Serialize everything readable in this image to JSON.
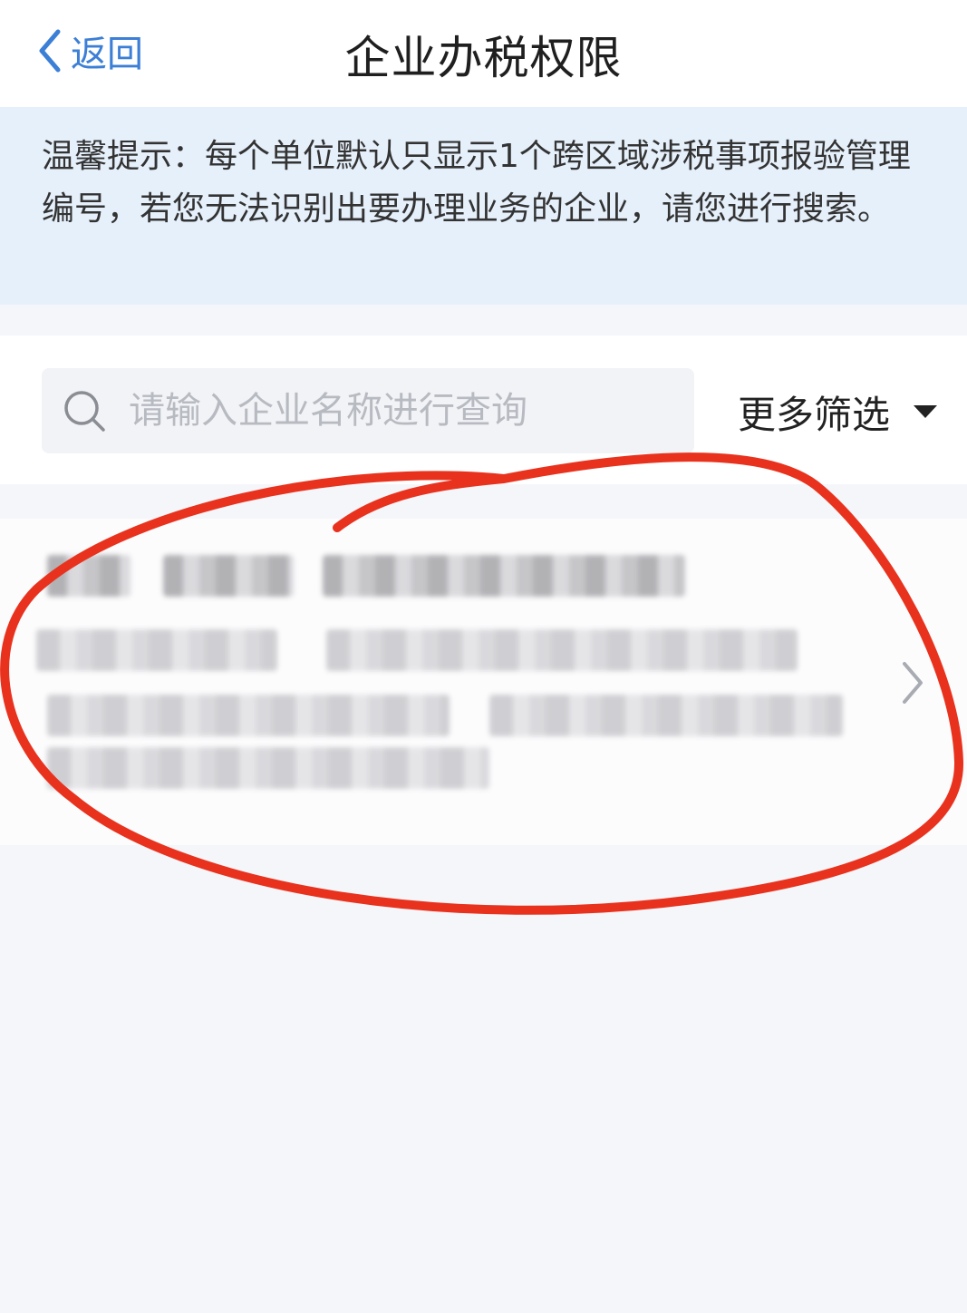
{
  "nav": {
    "back_label": "返回",
    "title": "企业办税权限"
  },
  "tip": {
    "text": "温馨提示：每个单位默认只显示1个跨区域涉税事项报验管理编号，若您无法识别出要办理业务的企业，请您进行搜索。"
  },
  "search": {
    "placeholder": "请输入企业名称进行查询",
    "value": ""
  },
  "filter": {
    "label": "更多筛选"
  },
  "colors": {
    "accent": "#3c7fd6",
    "tip_background": "#e6f0fb",
    "annotation": "#e8321e"
  },
  "icons": {
    "back": "chevron-left-icon",
    "search": "search-icon",
    "filter": "caret-down-icon",
    "row": "chevron-right-icon"
  }
}
